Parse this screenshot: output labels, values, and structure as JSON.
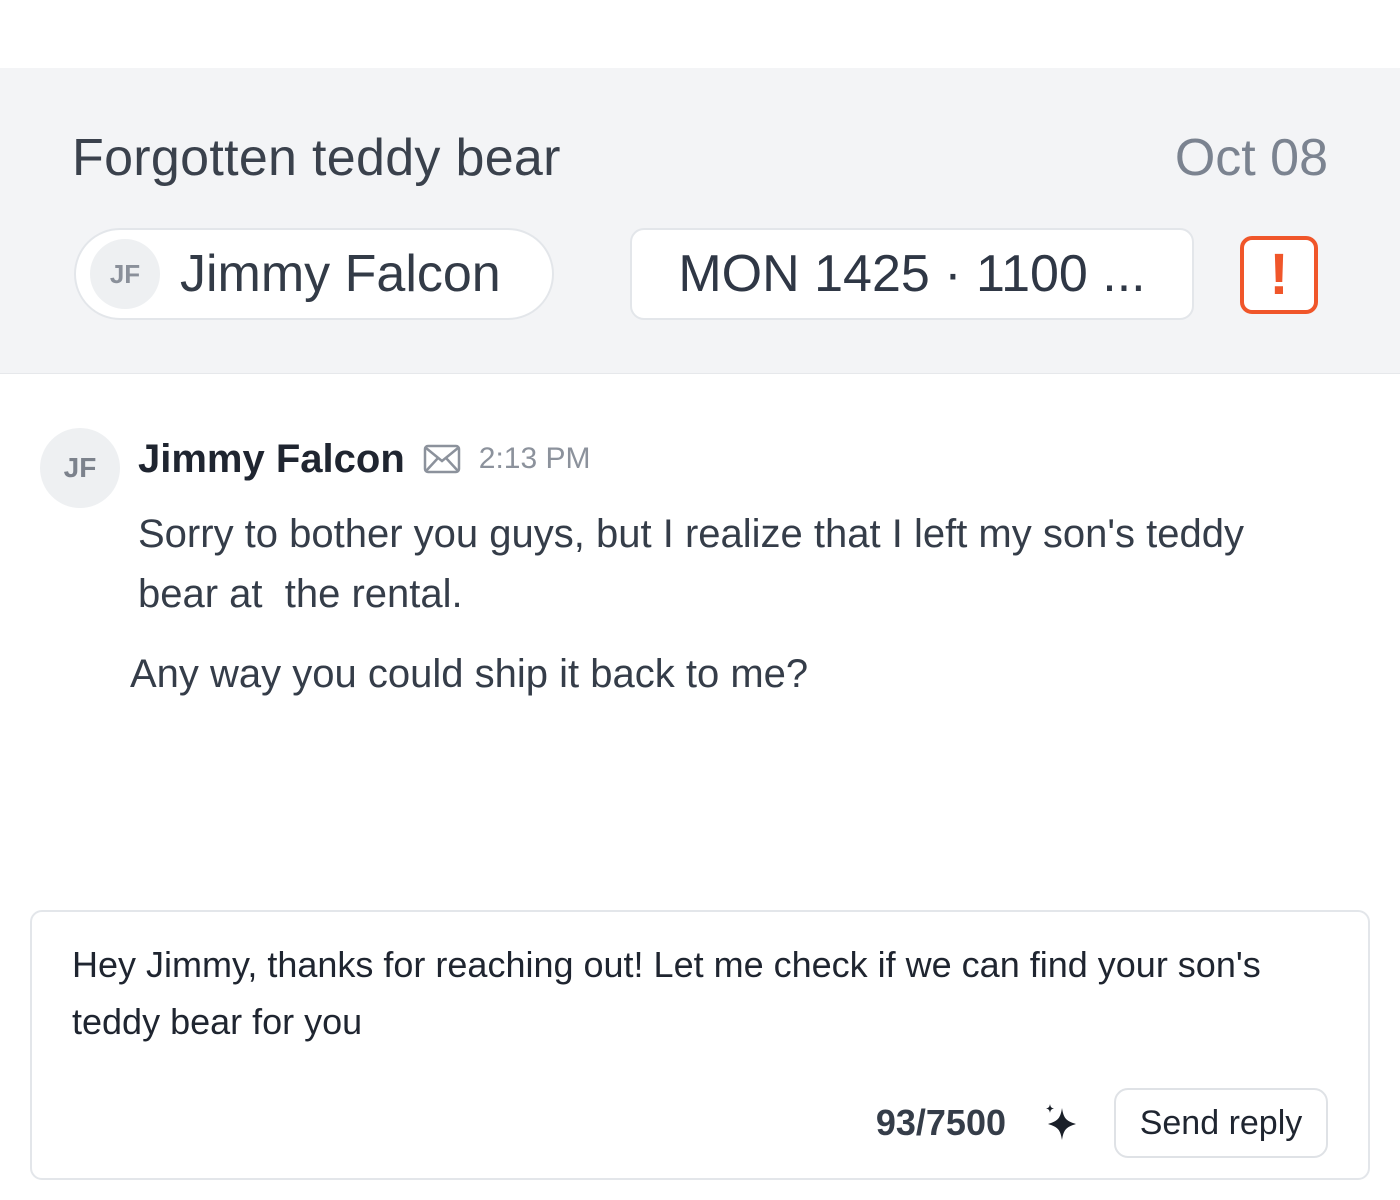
{
  "conversation": {
    "title": "Forgotten teddy bear",
    "date": "Oct 08",
    "contact": {
      "initials": "JF",
      "name": "Jimmy Falcon"
    },
    "booking": "MON 1425 · 1100 ...",
    "alert_icon": "exclamation-icon",
    "alert_symbol": "!",
    "alert_color": "#f0562a"
  },
  "message": {
    "initials": "JF",
    "sender": "Jimmy Falcon",
    "channel_icon": "mail-icon",
    "time": "2:13 PM",
    "lines": [
      "Sorry to bother you guys, but I realize that I left my son's teddy",
      "bear at  the rental.",
      "Any way you could ship it back to me?"
    ]
  },
  "reply": {
    "text": "Hey Jimmy, thanks for reaching out! Let me check if we can find your son's teddy bear for you",
    "counter": "93/7500",
    "ai_icon": "sparkle-icon",
    "send_label": "Send reply"
  }
}
